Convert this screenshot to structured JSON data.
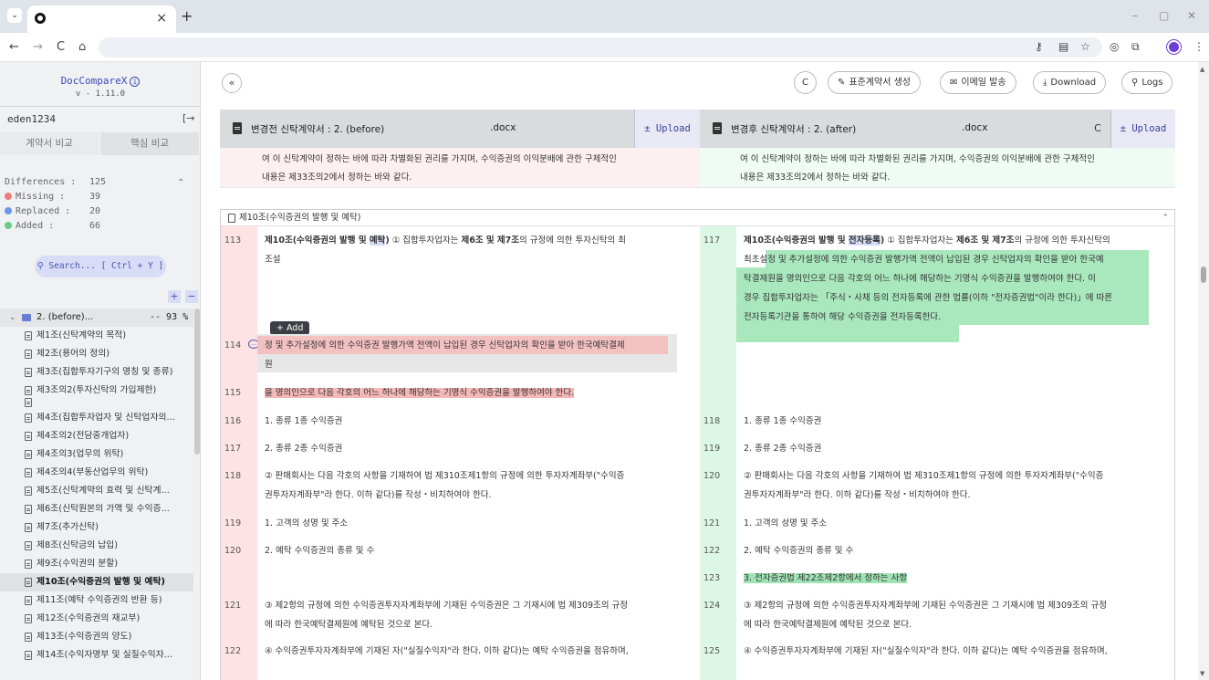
{
  "browser": {
    "tab_close": "×",
    "new_tab": "+",
    "win_min": "–",
    "win_max": "▢",
    "win_close": "✕",
    "nav_back": "←",
    "nav_forward": "→",
    "nav_reload": "C",
    "nav_home": "⌂"
  },
  "sidebar": {
    "brand": "DocCompareX",
    "info_glyph": "i",
    "version": "v - 1.11.0",
    "user": "eden1234",
    "logout_glyph": "[→",
    "tabs": [
      "계약서 비교",
      "핵심 비교"
    ],
    "stats": [
      {
        "label": "Differences :",
        "value": "125",
        "color": ""
      },
      {
        "label": "Missing :",
        "value": "39",
        "color": "#ee7d7d"
      },
      {
        "label": "Replaced :",
        "value": "20",
        "color": "#6f96e6"
      },
      {
        "label": "Added :",
        "value": "66",
        "color": "#66cc88"
      }
    ],
    "stats_chevron": "⌃",
    "search": "Search... [ Ctrl + Y ]",
    "plus": "+",
    "minus": "−",
    "tree_root": {
      "label": "2. (before)...",
      "pct": "-- 93 %"
    },
    "tree_items": [
      "제1조(신탁계약의 목적)",
      "제2조(용어의 정의)",
      "제3조(집합투자기구의 명칭 및 종류)",
      "제3조의2(투자신탁의 가입제한)",
      "",
      "제4조(집합투자업자 및 신탁업자의...",
      "제4조의2(전담중개업자)",
      "제4조의3(업무의 위탁)",
      "제4조의4(부동산업무의 위탁)",
      "제5조(신탁계약의 효력 및 신탁계...",
      "제6조(신탁원본의 가액 및 수익증...",
      "제7조(추가신탁)",
      "제8조(신탁금의 납입)",
      "제9조(수익권의 분할)",
      "제10조(수익증권의 발행 및 예탁)",
      "제11조(예탁 수익증권의 반환 등)",
      "제12조(수익증권의 재교부)",
      "제13조(수익증권의 양도)",
      "제14조(수익자명부 및 실질수익자..."
    ]
  },
  "toolbar": {
    "collapse": "«",
    "refresh": "C",
    "standard": "표준계약서 생성",
    "email": "이메일 발송",
    "download": "Download",
    "logs": "Logs"
  },
  "files": {
    "left_title": "변경전 신탁계약서 : 2. (before)",
    "left_ext": ".docx",
    "right_title": "변경후 신탁계약서 : 2. (after)",
    "right_ext": ".docx",
    "upload": "± Upload",
    "refresh": "C"
  },
  "prev_tail": {
    "left_1": "여 이 신탁계약이 정하는 바에 따라 차별화된 권리를 가지며, 수익증권의 이익분배에 관한 구체적인",
    "left_2": "내용은 제33조의2에서 정하는 바와 같다.",
    "right_1": "여 이 신탁계약이 정하는 바에 따라 차별화된 권리를 가지며, 수익증권의 이익분배에 관한 구체적인",
    "right_2": "내용은 제33조의2에서 정하는 바와 같다."
  },
  "section": {
    "title": "제10조(수익증권의 발행 및 예탁)",
    "collapse": "⌃",
    "add_tip": "+ Add",
    "left": {
      "r113": {
        "ln": "113",
        "a": "제10조(수익증권의 발행 및 ",
        "b": "예탁",
        "c": ") ① 집합투자업자는 ",
        "d": "제6조 및 제7조",
        "e": "의 규정에 의한 투자신탁의 최",
        "f": "조설"
      },
      "r114": {
        "ln": "114",
        "t1": "정 및 추가설정에 의한 수익증권 발행가액 전액이 납입된 경우 신탁업자의 확인을 받아 한국예탁결제",
        "t2": "원"
      },
      "r115": {
        "ln": "115",
        "t": "을 명의인으로 다음 각호의 어느 하나에 해당하는 기명식 수익증권을 발행하여야 한다."
      },
      "r116": {
        "ln": "116",
        "t": "1. 종류 1종 수익증권"
      },
      "r117": {
        "ln": "117",
        "t": "2. 종류 2종 수익증권"
      },
      "r118": {
        "ln": "118",
        "t1": "② 판매회사는 다음 각호의 사항을 기재하여 법 제310조제1항의 규정에 의한 투자자계좌부(\"수익증",
        "t2": "권투자자계좌부\"라 한다. 이하 같다)를 작성・비치하여야 한다."
      },
      "r119": {
        "ln": "119",
        "t": "1. 고객의 성명 및 주소"
      },
      "r120": {
        "ln": "120",
        "t": "2. 예탁 수익증권의 종류 및 수"
      },
      "r121": {
        "ln": "121",
        "t1": "③ 제2항의 규정에 의한 수익증권투자자계좌부에 기재된 수익증권은 그 기재시에 법 제309조의 규정",
        "t2": "에 따라 한국예탁결제원에 예탁된 것으로 본다."
      },
      "r122": {
        "ln": "122",
        "t": "④ 수익증권투자자계좌부에 기재된 자(\"실질수익자\"라 한다. 이하 같다)는 예탁 수익증권을 점유하며,"
      }
    },
    "right": {
      "r117": {
        "ln": "117",
        "a": "제10조(수익증권의 발행 및 ",
        "b": "전자등록",
        "c": ") ① 집합투자업자는 ",
        "d": "제6조 및 제7조",
        "e": "의 규정에 의한 투자신탁의",
        "l2a": "최초설",
        "l2b": "정 및 추가설정에 의한 수익증권 발행가액 전액이 납입된 경우 신탁업자의 확인을 받아 한국예",
        "l3": "탁결제원을 명의인으로 다음 각호의 어느 하나에 해당하는 기명식 수익증권을 발행하여야 한다. 이",
        "l4": "경우 집합투자업자는 「주식・사채 등의 전자등록에 관한 법률(이하 \"전자증권법\"이라 한다)」에 따른",
        "l5": "전자등록기관을 통하여 해당 수익증권을 전자등록한다."
      },
      "r118": {
        "ln": "118",
        "t": "1. 종류 1종 수익증권"
      },
      "r119": {
        "ln": "119",
        "t": "2. 종류 2종 수익증권"
      },
      "r120": {
        "ln": "120",
        "t1": "② 판매회사는 다음 각호의 사항을 기재하여 법 제310조제1항의 규정에 의한 투자자계좌부(\"수익증",
        "t2": "권투자자계좌부\"라 한다. 이하 같다)를 작성・비치하여야 한다."
      },
      "r121": {
        "ln": "121",
        "t": "1. 고객의 성명 및 주소"
      },
      "r122": {
        "ln": "122",
        "t": "2. 예탁 수익증권의 종류 및 수"
      },
      "r123": {
        "ln": "123",
        "t": "3. 전자증권법 제22조제2항에서 정하는 사항"
      },
      "r124": {
        "ln": "124",
        "t1": "③ 제2항의 규정에 의한 수익증권투자자계좌부에 기재된 수익증권은 그 기재시에 법 제309조의 규정",
        "t2": "에 따라 한국예탁결제원에 예탁된 것으로 본다."
      },
      "r125": {
        "ln": "125",
        "t": "④ 수익증권투자자계좌부에 기재된 자(\"실질수익자\"라 한다. 이하 같다)는 예탁 수익증권을 점유하며,"
      }
    }
  }
}
